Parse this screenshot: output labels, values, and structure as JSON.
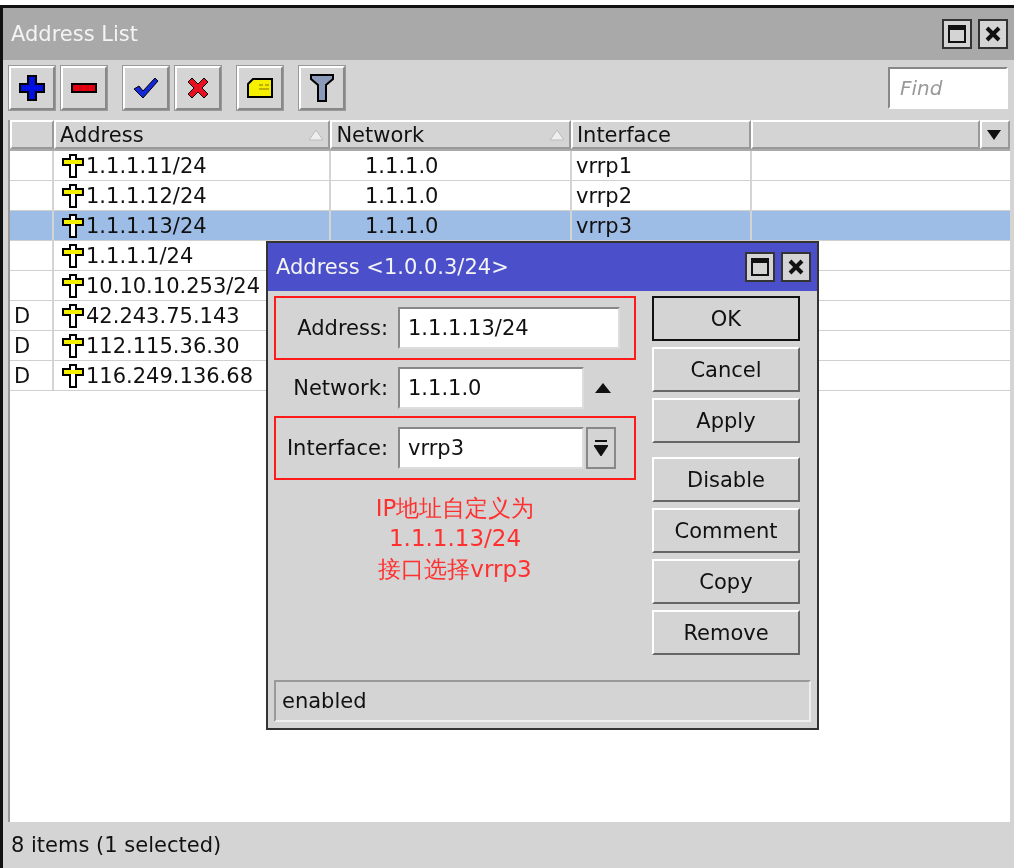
{
  "window": {
    "title": "Address List"
  },
  "toolbar": {
    "buttons": [
      {
        "kind": "add"
      },
      {
        "kind": "remove"
      },
      {
        "kind": "enable"
      },
      {
        "kind": "disable"
      },
      {
        "kind": "comment"
      },
      {
        "kind": "filter"
      }
    ],
    "find": {
      "placeholder": "Find"
    }
  },
  "table": {
    "columns": [
      {
        "label": "Address",
        "sortable": true
      },
      {
        "label": "Network",
        "sortable": true
      },
      {
        "label": "Interface",
        "sortable": false
      }
    ],
    "rows": [
      {
        "address": "1.1.1.11/24",
        "network": "1.1.1.0",
        "interface": "vrrp1",
        "selected": false
      },
      {
        "address": "1.1.1.12/24",
        "network": "1.1.1.0",
        "interface": "vrrp2",
        "selected": false
      },
      {
        "address": "1.1.1.13/24",
        "network": "1.1.1.0",
        "interface": "vrrp3",
        "selected": true
      },
      {
        "address": "1.1.1.1/24",
        "selected": false
      },
      {
        "address": "10.10.10.253/24",
        "selected": false
      },
      {
        "flag": "D",
        "address": "42.243.75.143",
        "selected": false
      },
      {
        "flag": "D",
        "address": "112.115.36.30",
        "selected": false
      },
      {
        "flag": "D",
        "address": "116.249.136.68",
        "selected": false
      }
    ]
  },
  "status_bar": "8 items (1 selected)",
  "dialog": {
    "title": "Address <1.0.0.3/24>",
    "fields": [
      {
        "kind": "text",
        "label": "Address:",
        "value": "1.1.1.13/24",
        "highlighted": true
      },
      {
        "kind": "collapse",
        "label": "Network:",
        "value": "1.1.1.0",
        "highlighted": false
      },
      {
        "kind": "dropdown",
        "label": "Interface:",
        "value": "vrrp3",
        "highlighted": true
      }
    ],
    "note": [
      "IP地址自定义为",
      "1.1.1.13/24",
      "接口选择vrrp3"
    ],
    "buttons": [
      {
        "label": "OK",
        "default": true
      },
      {
        "label": "Cancel",
        "default": false
      },
      {
        "label": "Apply",
        "default": false
      }
    ],
    "actions": [
      {
        "label": "Disable"
      },
      {
        "label": "Comment"
      },
      {
        "label": "Copy"
      },
      {
        "label": "Remove"
      }
    ],
    "status": "enabled"
  }
}
